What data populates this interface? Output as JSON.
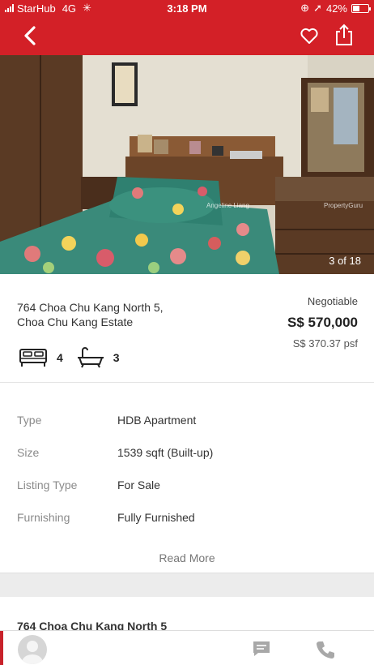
{
  "status_bar": {
    "carrier": "StarHub",
    "network": "4G",
    "time": "3:18 PM",
    "battery": "42%"
  },
  "listing": {
    "photo_counter": "3 of 18",
    "watermark_agent": "Angeline Liang",
    "watermark_brand": "PropertyGuru",
    "address_line1": "764 Choa Chu Kang North 5,",
    "address_line2": "Choa Chu Kang Estate",
    "negotiable": "Negotiable",
    "price": "S$ 570,000",
    "psf": "S$ 370.37 psf",
    "bedrooms": "4",
    "bathrooms": "3"
  },
  "details": [
    {
      "label": "Type",
      "value": "HDB Apartment"
    },
    {
      "label": "Size",
      "value": "1539 sqft (Built-up)"
    },
    {
      "label": "Listing Type",
      "value": "For Sale"
    },
    {
      "label": "Furnishing",
      "value": "Fully Furnished"
    }
  ],
  "read_more": "Read More",
  "next_section_title": "764 Choa Chu Kang North 5",
  "colors": {
    "brand": "#d32027"
  }
}
